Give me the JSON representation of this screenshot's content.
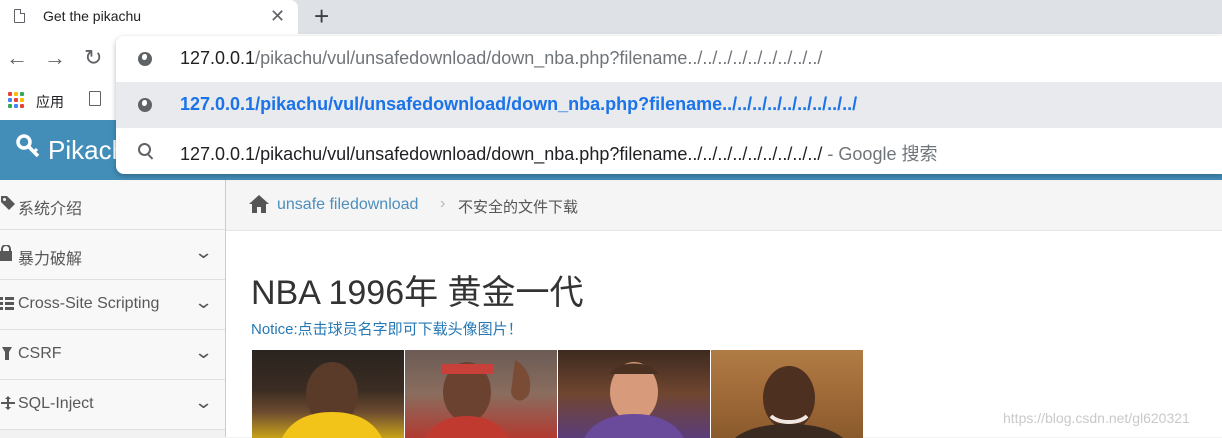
{
  "browser": {
    "tab_title": "Get the pikachu",
    "tab_close": "✕",
    "new_tab": "+",
    "nav": {
      "back": "←",
      "forward": "→",
      "reload": "↻"
    },
    "bookmarks": {
      "apps_label": "应用"
    }
  },
  "omnibox": {
    "typed_host": "127.0.0.1",
    "typed_path": "/pikachu/vul/unsafedownload/down_nba.php?filename../../../../../../../../../",
    "suggestion_url": "127.0.0.1/pikachu/vul/unsafedownload/down_nba.php?filename../../../../../../../../../",
    "search_query": "127.0.0.1/pikachu/vul/unsafedownload/down_nba.php?filename../../../../../../../../../",
    "search_suffix": " - Google 搜索"
  },
  "site": {
    "logo": "Pikachu"
  },
  "sidebar": {
    "items": [
      {
        "icon": "tag-icon",
        "label": "系统介绍",
        "has_chevron": false
      },
      {
        "icon": "lock-icon",
        "label": "暴力破解",
        "has_chevron": true
      },
      {
        "icon": "list-icon",
        "label": "Cross-Site Scripting",
        "has_chevron": true
      },
      {
        "icon": "wrench-icon",
        "label": "CSRF",
        "has_chevron": true
      },
      {
        "icon": "exchange-icon",
        "label": "SQL-Inject",
        "has_chevron": true
      }
    ]
  },
  "breadcrumb": {
    "link": "unsafe filedownload",
    "current": "不安全的文件下载"
  },
  "main": {
    "title": "NBA 1996年 黄金一代",
    "notice": "Notice:点击球员名字即可下载头像图片！"
  },
  "watermark": "https://blog.csdn.net/gl620321",
  "colors": {
    "topbar": "#438eb9",
    "link": "#4c8fbd",
    "omnibox_link": "#1a73e8"
  }
}
